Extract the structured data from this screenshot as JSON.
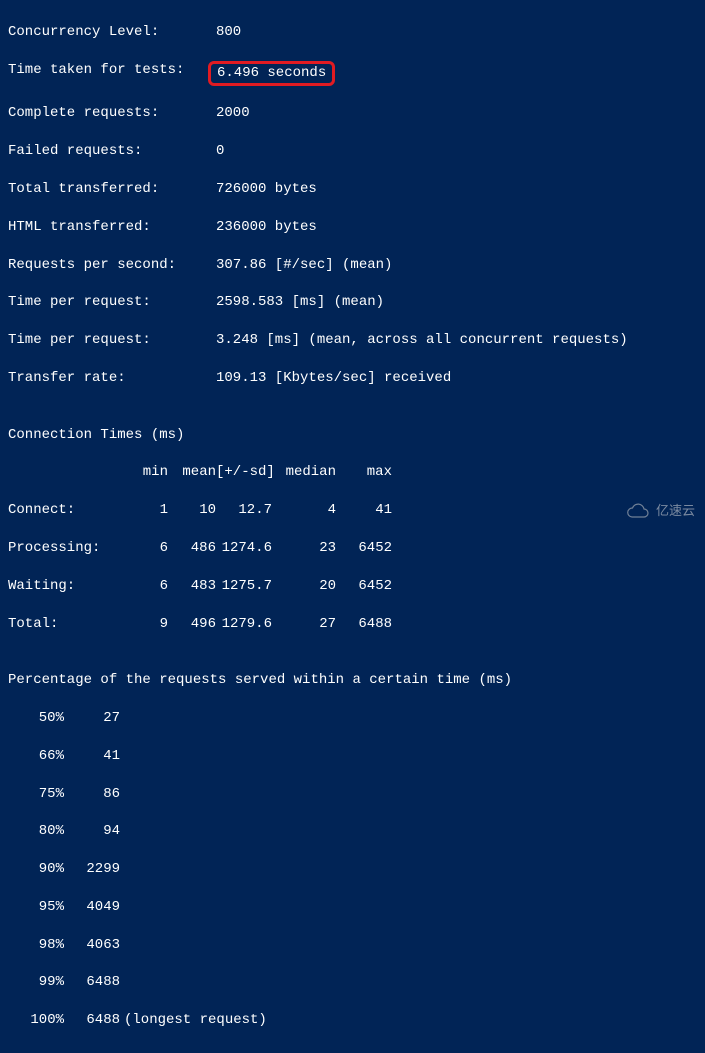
{
  "summary": {
    "concurrency_level": {
      "label": "Concurrency Level:",
      "value": "800"
    },
    "time_taken": {
      "label": "Time taken for tests:",
      "value": "6.496 seconds"
    },
    "complete_requests": {
      "label": "Complete requests:",
      "value": "2000"
    },
    "failed_requests": {
      "label": "Failed requests:",
      "value": "0"
    },
    "total_transferred": {
      "label": "Total transferred:",
      "value": "726000 bytes"
    },
    "html_transferred": {
      "label": "HTML transferred:",
      "value": "236000 bytes"
    },
    "requests_per_second": {
      "label": "Requests per second:",
      "value": "307.86 [#/sec] (mean)"
    },
    "time_per_request": {
      "label": "Time per request:",
      "value": "2598.583 [ms] (mean)"
    },
    "time_per_request_all": {
      "label": "Time per request:",
      "value": "3.248 [ms] (mean, across all concurrent requests)"
    },
    "transfer_rate": {
      "label": "Transfer rate:",
      "value": "109.13 [Kbytes/sec] received"
    }
  },
  "connection_times": {
    "title": "Connection Times (ms)",
    "header": {
      "min": "min",
      "mean": "mean",
      "sd": "[+/-sd]",
      "median": "median",
      "max": "max"
    },
    "rows": [
      {
        "label": "Connect:",
        "min": "1",
        "mean": "10",
        "sd": "12.7",
        "median": "4",
        "max": "41"
      },
      {
        "label": "Processing:",
        "min": "6",
        "mean": "486",
        "sd": "1274.6",
        "median": "23",
        "max": "6452"
      },
      {
        "label": "Waiting:",
        "min": "6",
        "mean": "483",
        "sd": "1275.7",
        "median": "20",
        "max": "6452"
      },
      {
        "label": "Total:",
        "min": "9",
        "mean": "496",
        "sd": "1279.6",
        "median": "27",
        "max": "6488"
      }
    ]
  },
  "percentiles": {
    "title": "Percentage of the requests served within a certain time (ms)",
    "rows": [
      {
        "pct": "50%",
        "value": "27",
        "note": ""
      },
      {
        "pct": "66%",
        "value": "41",
        "note": ""
      },
      {
        "pct": "75%",
        "value": "86",
        "note": ""
      },
      {
        "pct": "80%",
        "value": "94",
        "note": ""
      },
      {
        "pct": "90%",
        "value": "2299",
        "note": ""
      },
      {
        "pct": "95%",
        "value": "4049",
        "note": ""
      },
      {
        "pct": "98%",
        "value": "4063",
        "note": ""
      },
      {
        "pct": "99%",
        "value": "6488",
        "note": ""
      },
      {
        "pct": "100%",
        "value": "6488",
        "note": "(longest request)"
      }
    ]
  },
  "watermark": {
    "text": "亿速云"
  }
}
